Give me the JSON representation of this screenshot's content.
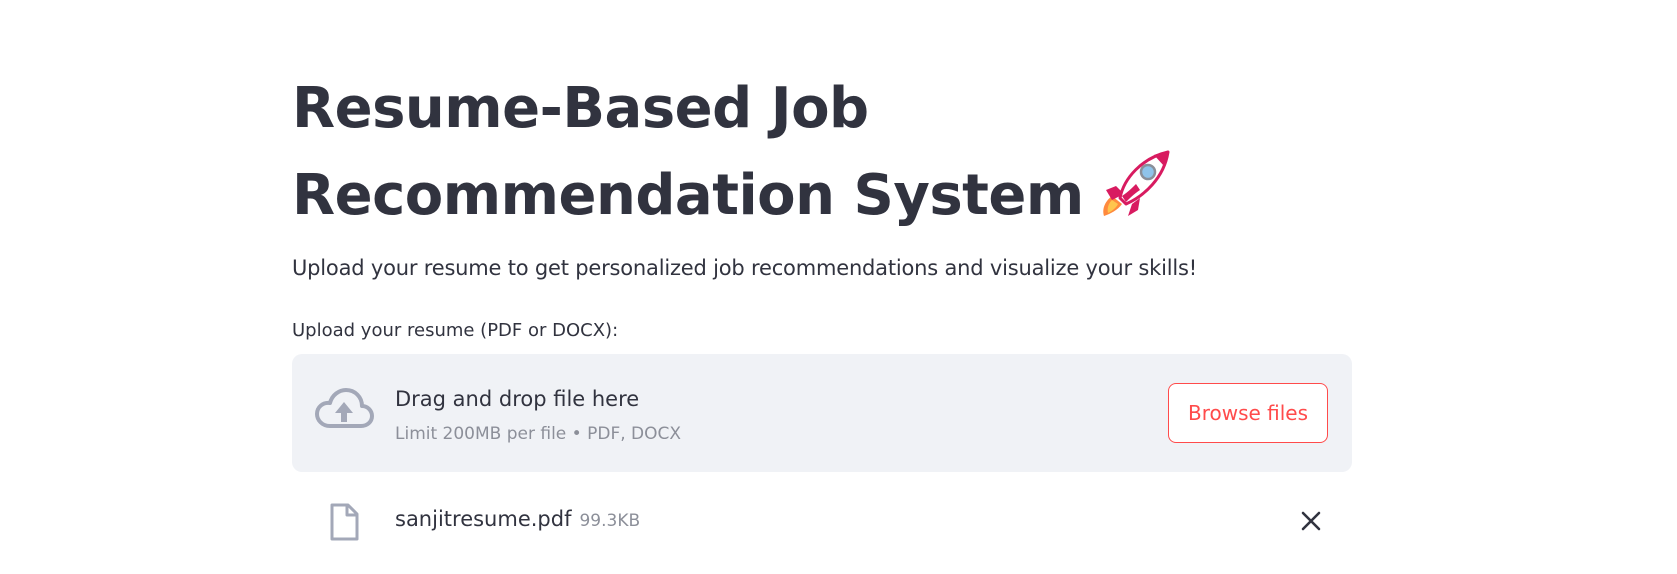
{
  "header": {
    "title_line1": "Resume-Based Job",
    "title_line2": "Recommendation System",
    "title_emoji_icon": "rocket-icon",
    "subtitle": "Upload your resume to get personalized job recommendations and visualize your skills!"
  },
  "uploader": {
    "label": "Upload your resume (PDF or DOCX):",
    "drag_text": "Drag and drop file here",
    "limit_text": "Limit 200MB per file • PDF, DOCX",
    "browse_label": "Browse files",
    "cloud_icon": "cloud-upload-icon"
  },
  "uploaded_file": {
    "name": "sanjitresume.pdf",
    "size": "99.3KB",
    "file_icon": "file-icon",
    "remove_icon": "close-icon"
  },
  "colors": {
    "text": "#31333f",
    "muted": "#8c8f99",
    "accent": "#ff4b4b",
    "dropzone_bg": "#f0f2f6",
    "icon": "#a3a8b8"
  }
}
